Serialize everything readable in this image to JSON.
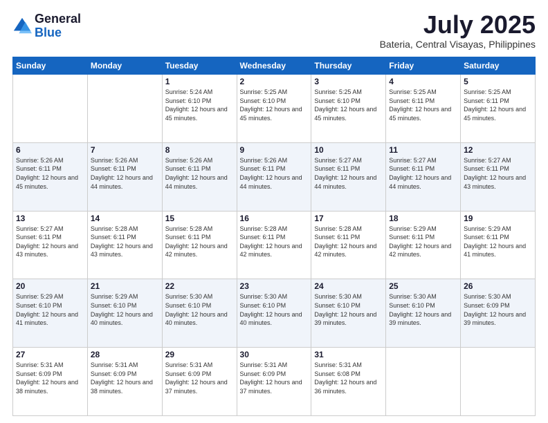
{
  "header": {
    "logo_general": "General",
    "logo_blue": "Blue",
    "month_year": "July 2025",
    "location": "Bateria, Central Visayas, Philippines"
  },
  "weekdays": [
    "Sunday",
    "Monday",
    "Tuesday",
    "Wednesday",
    "Thursday",
    "Friday",
    "Saturday"
  ],
  "weeks": [
    [
      {
        "day": "",
        "info": ""
      },
      {
        "day": "",
        "info": ""
      },
      {
        "day": "1",
        "info": "Sunrise: 5:24 AM\nSunset: 6:10 PM\nDaylight: 12 hours and 45 minutes."
      },
      {
        "day": "2",
        "info": "Sunrise: 5:25 AM\nSunset: 6:10 PM\nDaylight: 12 hours and 45 minutes."
      },
      {
        "day": "3",
        "info": "Sunrise: 5:25 AM\nSunset: 6:10 PM\nDaylight: 12 hours and 45 minutes."
      },
      {
        "day": "4",
        "info": "Sunrise: 5:25 AM\nSunset: 6:11 PM\nDaylight: 12 hours and 45 minutes."
      },
      {
        "day": "5",
        "info": "Sunrise: 5:25 AM\nSunset: 6:11 PM\nDaylight: 12 hours and 45 minutes."
      }
    ],
    [
      {
        "day": "6",
        "info": "Sunrise: 5:26 AM\nSunset: 6:11 PM\nDaylight: 12 hours and 45 minutes."
      },
      {
        "day": "7",
        "info": "Sunrise: 5:26 AM\nSunset: 6:11 PM\nDaylight: 12 hours and 44 minutes."
      },
      {
        "day": "8",
        "info": "Sunrise: 5:26 AM\nSunset: 6:11 PM\nDaylight: 12 hours and 44 minutes."
      },
      {
        "day": "9",
        "info": "Sunrise: 5:26 AM\nSunset: 6:11 PM\nDaylight: 12 hours and 44 minutes."
      },
      {
        "day": "10",
        "info": "Sunrise: 5:27 AM\nSunset: 6:11 PM\nDaylight: 12 hours and 44 minutes."
      },
      {
        "day": "11",
        "info": "Sunrise: 5:27 AM\nSunset: 6:11 PM\nDaylight: 12 hours and 44 minutes."
      },
      {
        "day": "12",
        "info": "Sunrise: 5:27 AM\nSunset: 6:11 PM\nDaylight: 12 hours and 43 minutes."
      }
    ],
    [
      {
        "day": "13",
        "info": "Sunrise: 5:27 AM\nSunset: 6:11 PM\nDaylight: 12 hours and 43 minutes."
      },
      {
        "day": "14",
        "info": "Sunrise: 5:28 AM\nSunset: 6:11 PM\nDaylight: 12 hours and 43 minutes."
      },
      {
        "day": "15",
        "info": "Sunrise: 5:28 AM\nSunset: 6:11 PM\nDaylight: 12 hours and 42 minutes."
      },
      {
        "day": "16",
        "info": "Sunrise: 5:28 AM\nSunset: 6:11 PM\nDaylight: 12 hours and 42 minutes."
      },
      {
        "day": "17",
        "info": "Sunrise: 5:28 AM\nSunset: 6:11 PM\nDaylight: 12 hours and 42 minutes."
      },
      {
        "day": "18",
        "info": "Sunrise: 5:29 AM\nSunset: 6:11 PM\nDaylight: 12 hours and 42 minutes."
      },
      {
        "day": "19",
        "info": "Sunrise: 5:29 AM\nSunset: 6:11 PM\nDaylight: 12 hours and 41 minutes."
      }
    ],
    [
      {
        "day": "20",
        "info": "Sunrise: 5:29 AM\nSunset: 6:10 PM\nDaylight: 12 hours and 41 minutes."
      },
      {
        "day": "21",
        "info": "Sunrise: 5:29 AM\nSunset: 6:10 PM\nDaylight: 12 hours and 40 minutes."
      },
      {
        "day": "22",
        "info": "Sunrise: 5:30 AM\nSunset: 6:10 PM\nDaylight: 12 hours and 40 minutes."
      },
      {
        "day": "23",
        "info": "Sunrise: 5:30 AM\nSunset: 6:10 PM\nDaylight: 12 hours and 40 minutes."
      },
      {
        "day": "24",
        "info": "Sunrise: 5:30 AM\nSunset: 6:10 PM\nDaylight: 12 hours and 39 minutes."
      },
      {
        "day": "25",
        "info": "Sunrise: 5:30 AM\nSunset: 6:10 PM\nDaylight: 12 hours and 39 minutes."
      },
      {
        "day": "26",
        "info": "Sunrise: 5:30 AM\nSunset: 6:09 PM\nDaylight: 12 hours and 39 minutes."
      }
    ],
    [
      {
        "day": "27",
        "info": "Sunrise: 5:31 AM\nSunset: 6:09 PM\nDaylight: 12 hours and 38 minutes."
      },
      {
        "day": "28",
        "info": "Sunrise: 5:31 AM\nSunset: 6:09 PM\nDaylight: 12 hours and 38 minutes."
      },
      {
        "day": "29",
        "info": "Sunrise: 5:31 AM\nSunset: 6:09 PM\nDaylight: 12 hours and 37 minutes."
      },
      {
        "day": "30",
        "info": "Sunrise: 5:31 AM\nSunset: 6:09 PM\nDaylight: 12 hours and 37 minutes."
      },
      {
        "day": "31",
        "info": "Sunrise: 5:31 AM\nSunset: 6:08 PM\nDaylight: 12 hours and 36 minutes."
      },
      {
        "day": "",
        "info": ""
      },
      {
        "day": "",
        "info": ""
      }
    ]
  ]
}
